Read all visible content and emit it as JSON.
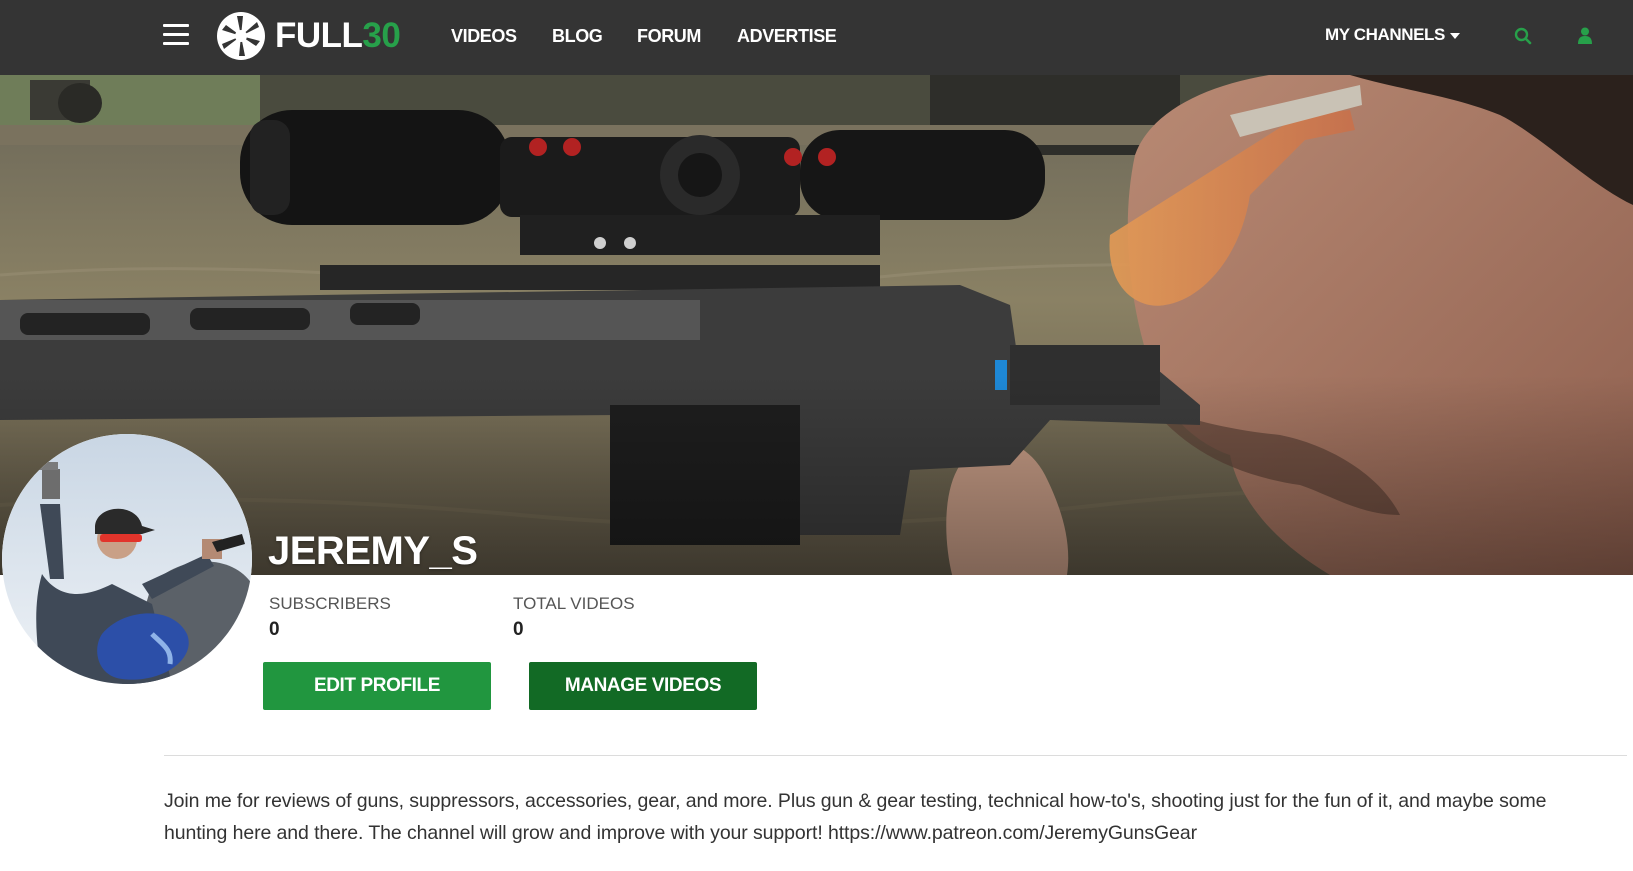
{
  "colors": {
    "nav_background": "#343434",
    "accent_green": "#27a04a",
    "edit_button": "#21963f",
    "manage_button": "#126a25"
  },
  "header": {
    "logo_text": "FULL",
    "logo_number": "30",
    "nav": [
      "VIDEOS",
      "BLOG",
      "FORUM",
      "ADVERTISE"
    ],
    "my_channels_label": "MY CHANNELS",
    "icons": [
      "hamburger-icon",
      "aperture-logo-icon",
      "caret-down-icon",
      "search-icon",
      "user-icon"
    ]
  },
  "channel": {
    "name": "JEREMY_S",
    "stats": [
      {
        "label": "SUBSCRIBERS",
        "value": "0"
      },
      {
        "label": "TOTAL VIDEOS",
        "value": "0"
      }
    ],
    "buttons": {
      "edit_profile": "EDIT PROFILE",
      "manage_videos": "MANAGE VIDEOS"
    },
    "description": "Join me for reviews of guns, suppressors, accessories, gear, and more. Plus gun & gear testing, technical how-to's, shooting just for the fun of it, and maybe some hunting here and there. The channel will grow and improve with your support! https://www.patreon.com/JeremyGunsGear"
  }
}
